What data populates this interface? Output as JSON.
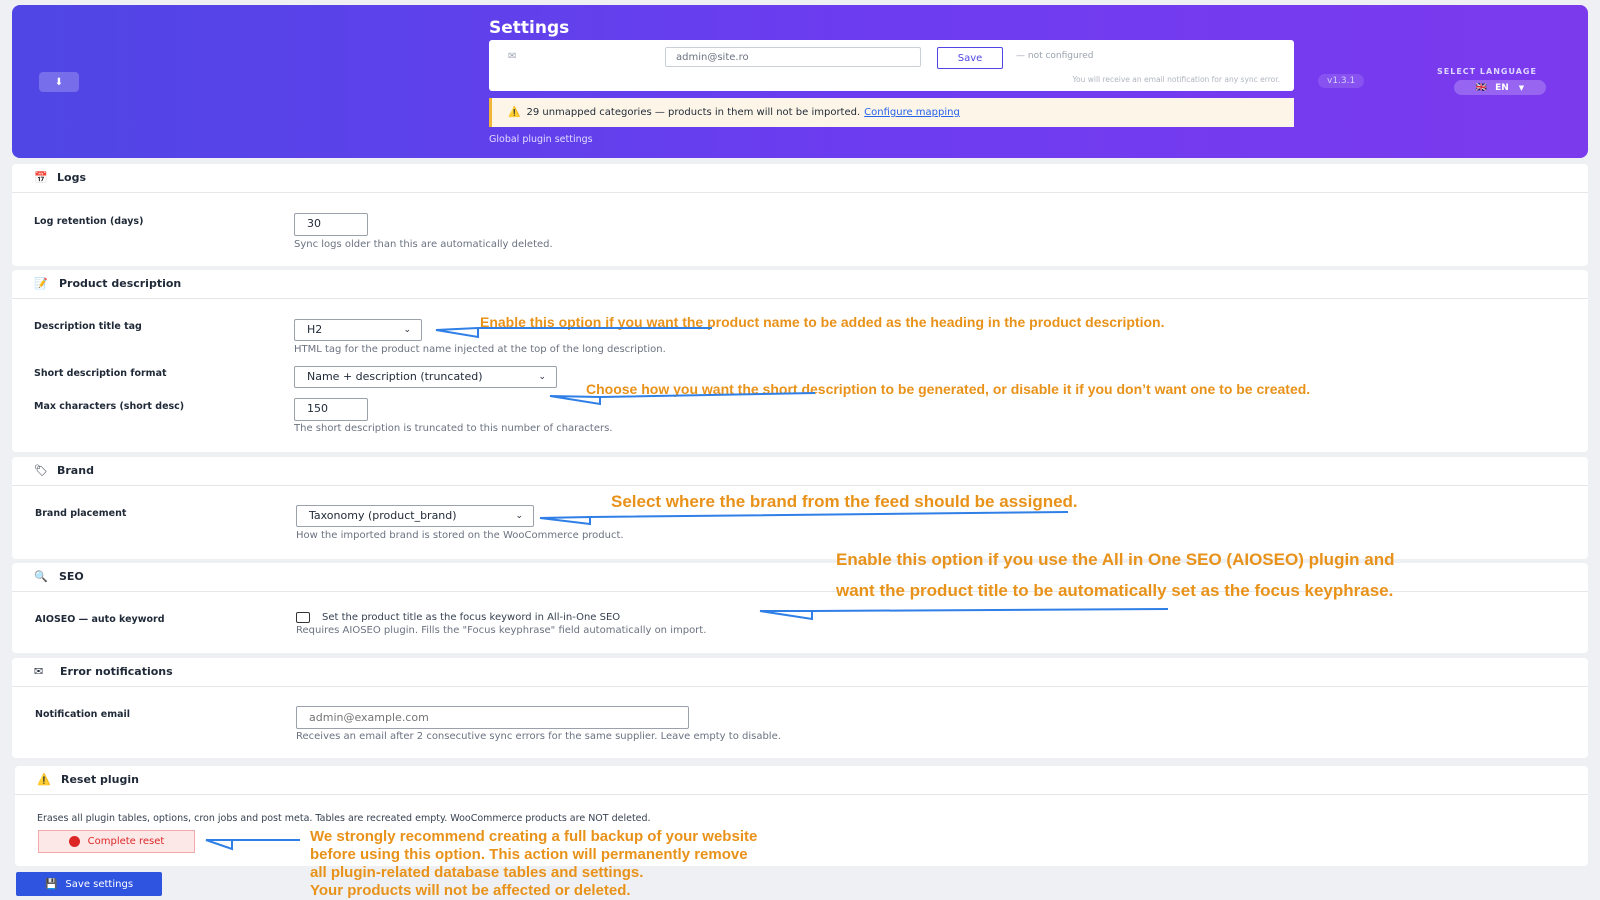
{
  "header": {
    "title": "Settings",
    "home_icon": "download-icon",
    "email_field_value": "admin@site.ro",
    "save_label": "Save",
    "status": "— not configured",
    "hint": "You will receive an email notification for any sync error.",
    "warning_text": "29 unmapped categories — products in them will not be imported.",
    "warning_link": "Configure mapping",
    "subtitle": "Global plugin settings",
    "version": "v1.3.1",
    "language_label": "SELECT LANGUAGE",
    "language_flag": "🇬🇧",
    "language_value": "EN",
    "accent_color": "#6d3cf0"
  },
  "logs": {
    "title": "Logs",
    "retention_label": "Log retention (days)",
    "retention_value": "30",
    "retention_desc": "Sync logs older than this are automatically deleted."
  },
  "product_description": {
    "title": "Product description",
    "title_tag_label": "Description title tag",
    "title_tag_value": "H2",
    "title_tag_desc": "HTML tag for the product name injected at the top of the long description.",
    "short_format_label": "Short description format",
    "short_format_value": "Name + description (truncated)",
    "max_chars_label": "Max characters (short desc)",
    "max_chars_value": "150",
    "max_chars_desc": "The short description is truncated to this number of characters."
  },
  "brand": {
    "title": "Brand",
    "placement_label": "Brand placement",
    "placement_value": "Taxonomy (product_brand)",
    "placement_desc": "How the imported brand is stored on the WooCommerce product."
  },
  "seo": {
    "title": "SEO",
    "aioseo_label": "AIOSEO — auto keyword",
    "checkbox_text": "Set the product title as the focus keyword in All-in-One SEO",
    "checkbox_desc": "Requires AIOSEO plugin. Fills the \"Focus keyphrase\" field automatically on import."
  },
  "error_notifications": {
    "title": "Error notifications",
    "email_label": "Notification email",
    "email_placeholder": "admin@example.com",
    "email_desc": "Receives an email after 2 consecutive sync errors for the same supplier. Leave empty to disable."
  },
  "reset": {
    "title": "Reset plugin",
    "desc": "Erases all plugin tables, options, cron jobs and post meta. Tables are recreated empty. WooCommerce products are NOT deleted.",
    "button_label": "Complete reset"
  },
  "footer": {
    "save_label": "Save settings"
  },
  "annotations": {
    "title_tag": "Enable this option if you want the product name to be added as the heading in the product description.",
    "short_desc": "Choose how you want the short description to be generated, or disable it if you don’t want one to be created.",
    "brand": "Select where the brand from the feed should be assigned.",
    "seo_line1": "Enable this option if you use the All in One SEO (AIOSEO) plugin and",
    "seo_line2": "want the product title to be automatically set as the focus keyphrase.",
    "reset_line1": "We strongly recommend creating a full backup of your website",
    "reset_line2": "before using this option. This action will permanently remove",
    "reset_line3": "all plugin-related database tables and settings.",
    "reset_line4": "Your products  will not be affected or deleted.",
    "note_color": "#e8921a",
    "arrow_color": "#2f7fe6"
  }
}
